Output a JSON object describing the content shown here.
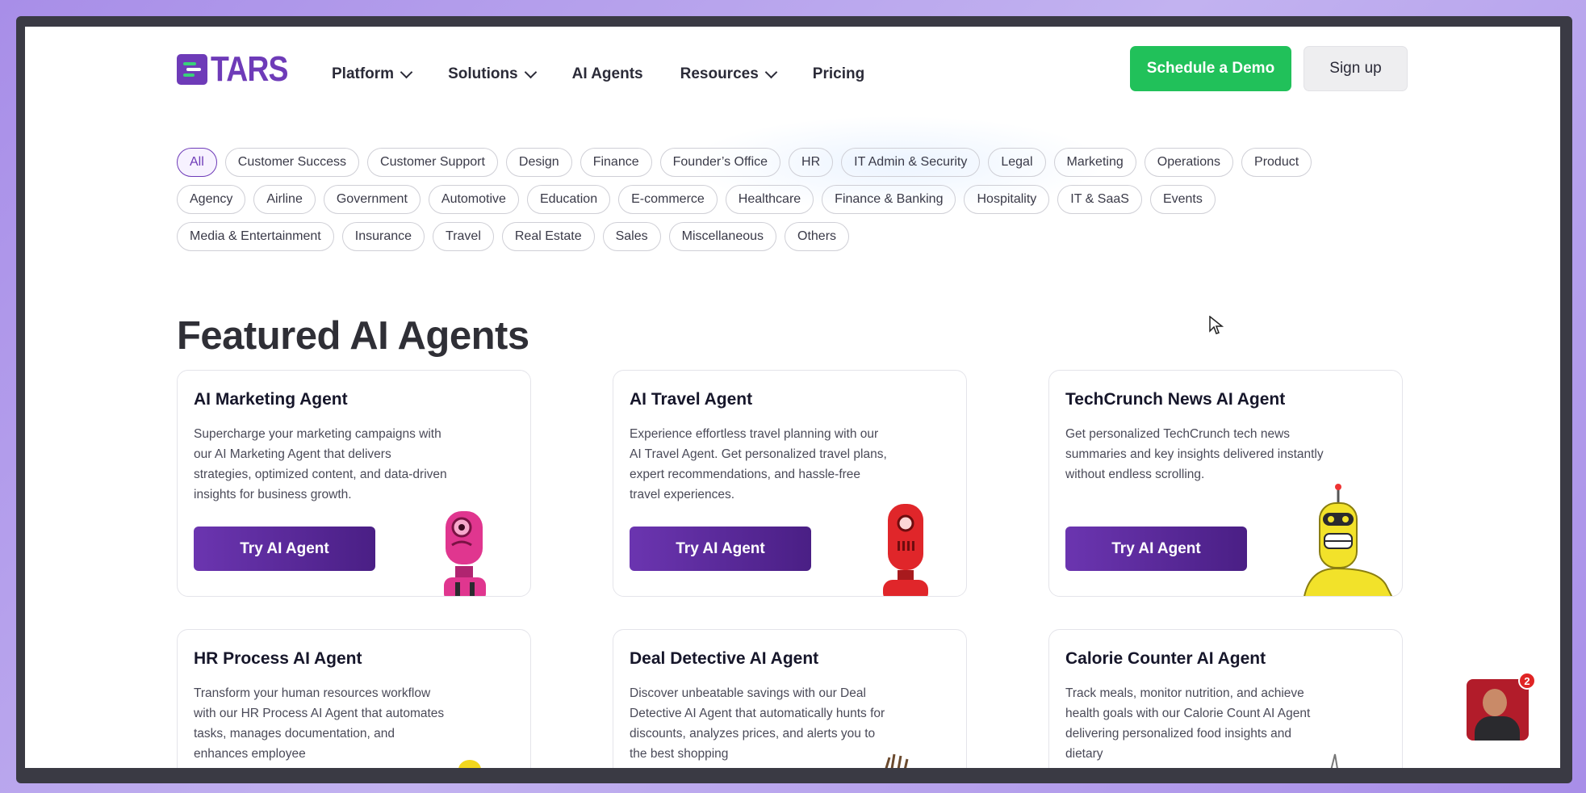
{
  "brand": {
    "name": "TARS",
    "color": "#6e3bb8"
  },
  "nav": {
    "items": [
      {
        "label": "Platform",
        "dropdown": true
      },
      {
        "label": "Solutions",
        "dropdown": true
      },
      {
        "label": "AI Agents",
        "dropdown": false
      },
      {
        "label": "Resources",
        "dropdown": true
      },
      {
        "label": "Pricing",
        "dropdown": false
      }
    ],
    "demo_label": "Schedule a Demo",
    "signup_label": "Sign up"
  },
  "filters": {
    "rows": [
      [
        "All",
        "Customer Success",
        "Customer Support",
        "Design",
        "Finance",
        "Founder’s Office",
        "HR",
        "IT Admin & Security",
        "Legal",
        "Marketing",
        "Operations",
        "Product"
      ],
      [
        "Agency",
        "Airline",
        "Government",
        "Automotive",
        "Education",
        "E-commerce",
        "Healthcare",
        "Finance & Banking",
        "Hospitality",
        "IT & SaaS",
        "Events"
      ],
      [
        "Media & Entertainment",
        "Insurance",
        "Travel",
        "Real Estate",
        "Sales",
        "Miscellaneous",
        "Others"
      ]
    ],
    "active": "All"
  },
  "section_title": "Featured AI Agents",
  "cards": [
    {
      "title": "AI Marketing Agent",
      "description": "Supercharge your marketing campaigns with our AI Marketing Agent that delivers strategies, optimized content, and data-driven insights for business growth.",
      "button": "Try AI Agent",
      "robot": "pink-robot-icon"
    },
    {
      "title": "AI Travel Agent",
      "description": "Experience effortless travel planning with our AI Travel Agent. Get personalized travel plans, expert recommendations, and hassle-free travel experiences.",
      "button": "Try AI Agent",
      "robot": "red-robot-icon"
    },
    {
      "title": "TechCrunch News AI Agent",
      "description": "Get personalized TechCrunch tech news summaries and key insights delivered instantly without endless scrolling.",
      "button": "Try AI Agent",
      "robot": "yellow-robot-icon"
    },
    {
      "title": "HR Process AI Agent",
      "description": "Transform your human resources workflow with our HR Process AI Agent that automates tasks, manages documentation, and enhances employee",
      "button": "",
      "robot": "yellow-robot-icon"
    },
    {
      "title": "Deal Detective AI Agent",
      "description": "Discover unbeatable savings with our Deal Detective AI Agent that automatically hunts for discounts, analyzes prices, and alerts you to the best shopping",
      "button": "",
      "robot": "brown-robot-icon"
    },
    {
      "title": "Calorie Counter AI Agent",
      "description": "Track meals, monitor nutrition, and achieve health goals with our Calorie Count AI Agent delivering personalized food insights and dietary",
      "button": "",
      "robot": "grey-robot-icon"
    }
  ],
  "chat_widget": {
    "badge": "2"
  }
}
